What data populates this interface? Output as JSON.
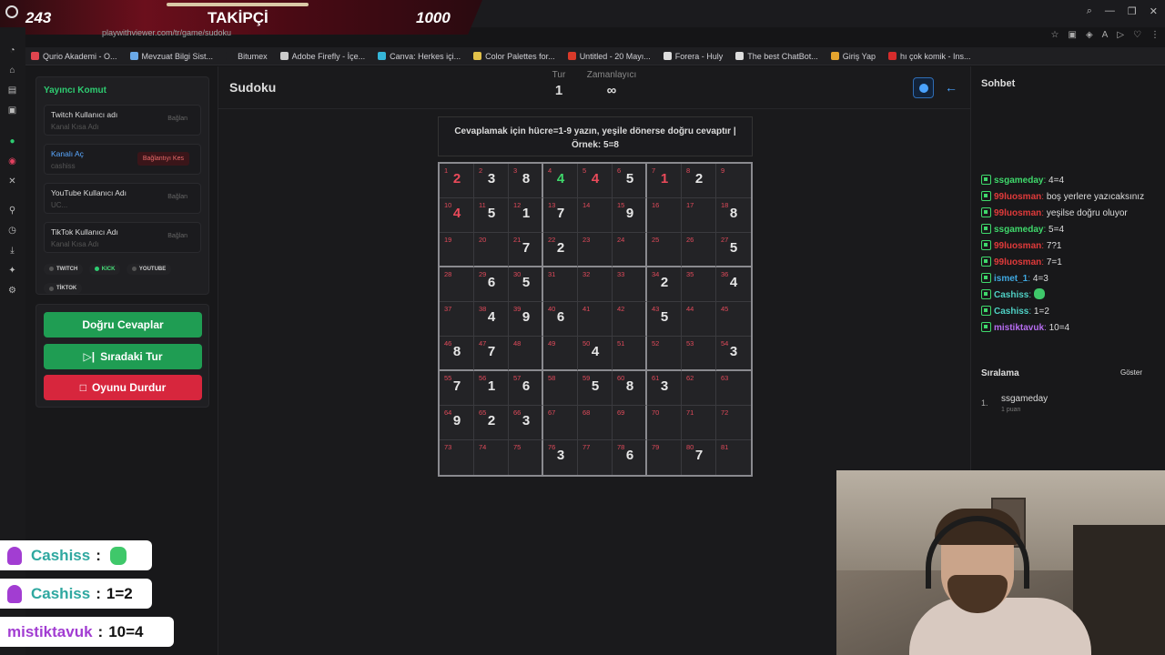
{
  "overlay": {
    "follower_count": "243",
    "title": "TAKİPÇİ",
    "goal": "1000"
  },
  "browser": {
    "url": "playwithviewer.com/tr/game/sudoku",
    "bookmarks": [
      {
        "label": "Qurio Akademi - O...",
        "color": "#e0454f"
      },
      {
        "label": "Mevzuat Bilgi Sist...",
        "color": "#6aa9e8"
      },
      {
        "label": "Bitumex",
        "color": "#1f1f22"
      },
      {
        "label": "Adobe Firefly - İçe...",
        "color": "#cccccc"
      },
      {
        "label": "Canva: Herkes içi...",
        "color": "#35b6d8"
      },
      {
        "label": "Color Palettes for...",
        "color": "#e2c14a"
      },
      {
        "label": "Untitled - 20 Mayı...",
        "color": "#d93a2a"
      },
      {
        "label": "Forera - Huly",
        "color": "#dddddd"
      },
      {
        "label": "The best ChatBot...",
        "color": "#dddddd"
      },
      {
        "label": "Giriş Yap",
        "color": "#e3a32e"
      },
      {
        "label": "hı çok komik - Ins...",
        "color": "#d62c2c"
      }
    ]
  },
  "streamer": {
    "title": "Yayıncı Komut",
    "accounts": [
      {
        "label": "Twitch Kullanıcı adı",
        "value": "Kanal Kısa Adı",
        "button": "Bağlan"
      },
      {
        "label": "Kanalı Aç",
        "value": "cashiss",
        "button": "Bağlantıyı Kes"
      },
      {
        "label": "YouTube Kullanıcı Adı",
        "value": "UC...",
        "button": "Bağlan"
      },
      {
        "label": "TikTok Kullanıcı Adı",
        "value": "Kanal Kısa Adı",
        "button": "Bağlan"
      }
    ],
    "chips": [
      "TWITCH",
      "KICK",
      "YOUTUBE",
      "TİKTOK"
    ]
  },
  "actions": {
    "correct": "Doğru Cevaplar",
    "next": "Sıradaki Tur",
    "stop": "Oyunu Durdur"
  },
  "game": {
    "title": "Sudoku",
    "round_label": "Tur",
    "round_value": "1",
    "timer_label": "Zamanlayıcı",
    "timer_value": "∞",
    "instruction_line1": "Cevaplamak için hücre=1-9 yazın, yeşile dönerse doğru cevaptır |",
    "instruction_line2": "Örnek: 5=8",
    "cells": {
      "1": [
        "2",
        "red"
      ],
      "2": [
        "3",
        ""
      ],
      "3": [
        "8",
        ""
      ],
      "4": [
        "4",
        "green"
      ],
      "5": [
        "4",
        "red"
      ],
      "6": [
        "5",
        ""
      ],
      "7": [
        "1",
        "red"
      ],
      "8": [
        "2",
        ""
      ],
      "10": [
        "4",
        "red"
      ],
      "11": [
        "5",
        ""
      ],
      "12": [
        "1",
        ""
      ],
      "13": [
        "7",
        ""
      ],
      "15": [
        "9",
        ""
      ],
      "18": [
        "8",
        ""
      ],
      "21": [
        "7",
        ""
      ],
      "22": [
        "2",
        ""
      ],
      "27": [
        "5",
        ""
      ],
      "29": [
        "6",
        ""
      ],
      "30": [
        "5",
        ""
      ],
      "34": [
        "2",
        ""
      ],
      "36": [
        "4",
        ""
      ],
      "38": [
        "4",
        ""
      ],
      "39": [
        "9",
        ""
      ],
      "40": [
        "6",
        ""
      ],
      "43": [
        "5",
        ""
      ],
      "46": [
        "8",
        ""
      ],
      "47": [
        "7",
        ""
      ],
      "50": [
        "4",
        ""
      ],
      "54": [
        "3",
        ""
      ],
      "55": [
        "7",
        ""
      ],
      "56": [
        "1",
        ""
      ],
      "57": [
        "6",
        ""
      ],
      "59": [
        "5",
        ""
      ],
      "60": [
        "8",
        ""
      ],
      "61": [
        "3",
        ""
      ],
      "64": [
        "9",
        ""
      ],
      "65": [
        "2",
        ""
      ],
      "66": [
        "3",
        ""
      ],
      "76": [
        "3",
        ""
      ],
      "78": [
        "6",
        ""
      ],
      "80": [
        "7",
        ""
      ]
    }
  },
  "chat": {
    "title": "Sohbet",
    "messages": [
      {
        "user": "ssgameday",
        "color": "#3fd86b",
        "text": "4=4"
      },
      {
        "user": "99luosman",
        "color": "#e03a3a",
        "text": "boş yerlere yazıcaksınız"
      },
      {
        "user": "99luosman",
        "color": "#e03a3a",
        "text": "yeşilse doğru oluyor"
      },
      {
        "user": "ssgameday",
        "color": "#3fd86b",
        "text": "5=4"
      },
      {
        "user": "99luosman",
        "color": "#e03a3a",
        "text": "7?1"
      },
      {
        "user": "99luosman",
        "color": "#e03a3a",
        "text": "7=1"
      },
      {
        "user": "ismet_1",
        "color": "#3fa8e0",
        "text": "4=3"
      },
      {
        "user": "Cashiss",
        "color": "#4fd1c5",
        "text": ""
      },
      {
        "user": "Cashiss",
        "color": "#4fd1c5",
        "text": "1=2"
      },
      {
        "user": "mistiktavuk",
        "color": "#b66df0",
        "text": "10=4"
      }
    ],
    "ranking_title": "Sıralama",
    "show_label": "Göster",
    "ranking": [
      {
        "pos": "1.",
        "name": "ssgameday",
        "points": "1 puan"
      }
    ]
  },
  "overlay_chat": [
    {
      "user": "Cashiss",
      "sep": ":",
      "text": "",
      "color": "teal",
      "emote": true
    },
    {
      "user": "Cashiss",
      "sep": ":",
      "text": "1=2",
      "color": "teal",
      "emote": false
    },
    {
      "user": "mistiktavuk",
      "sep": ":",
      "text": "10=4",
      "color": "purple",
      "emote": false
    }
  ]
}
